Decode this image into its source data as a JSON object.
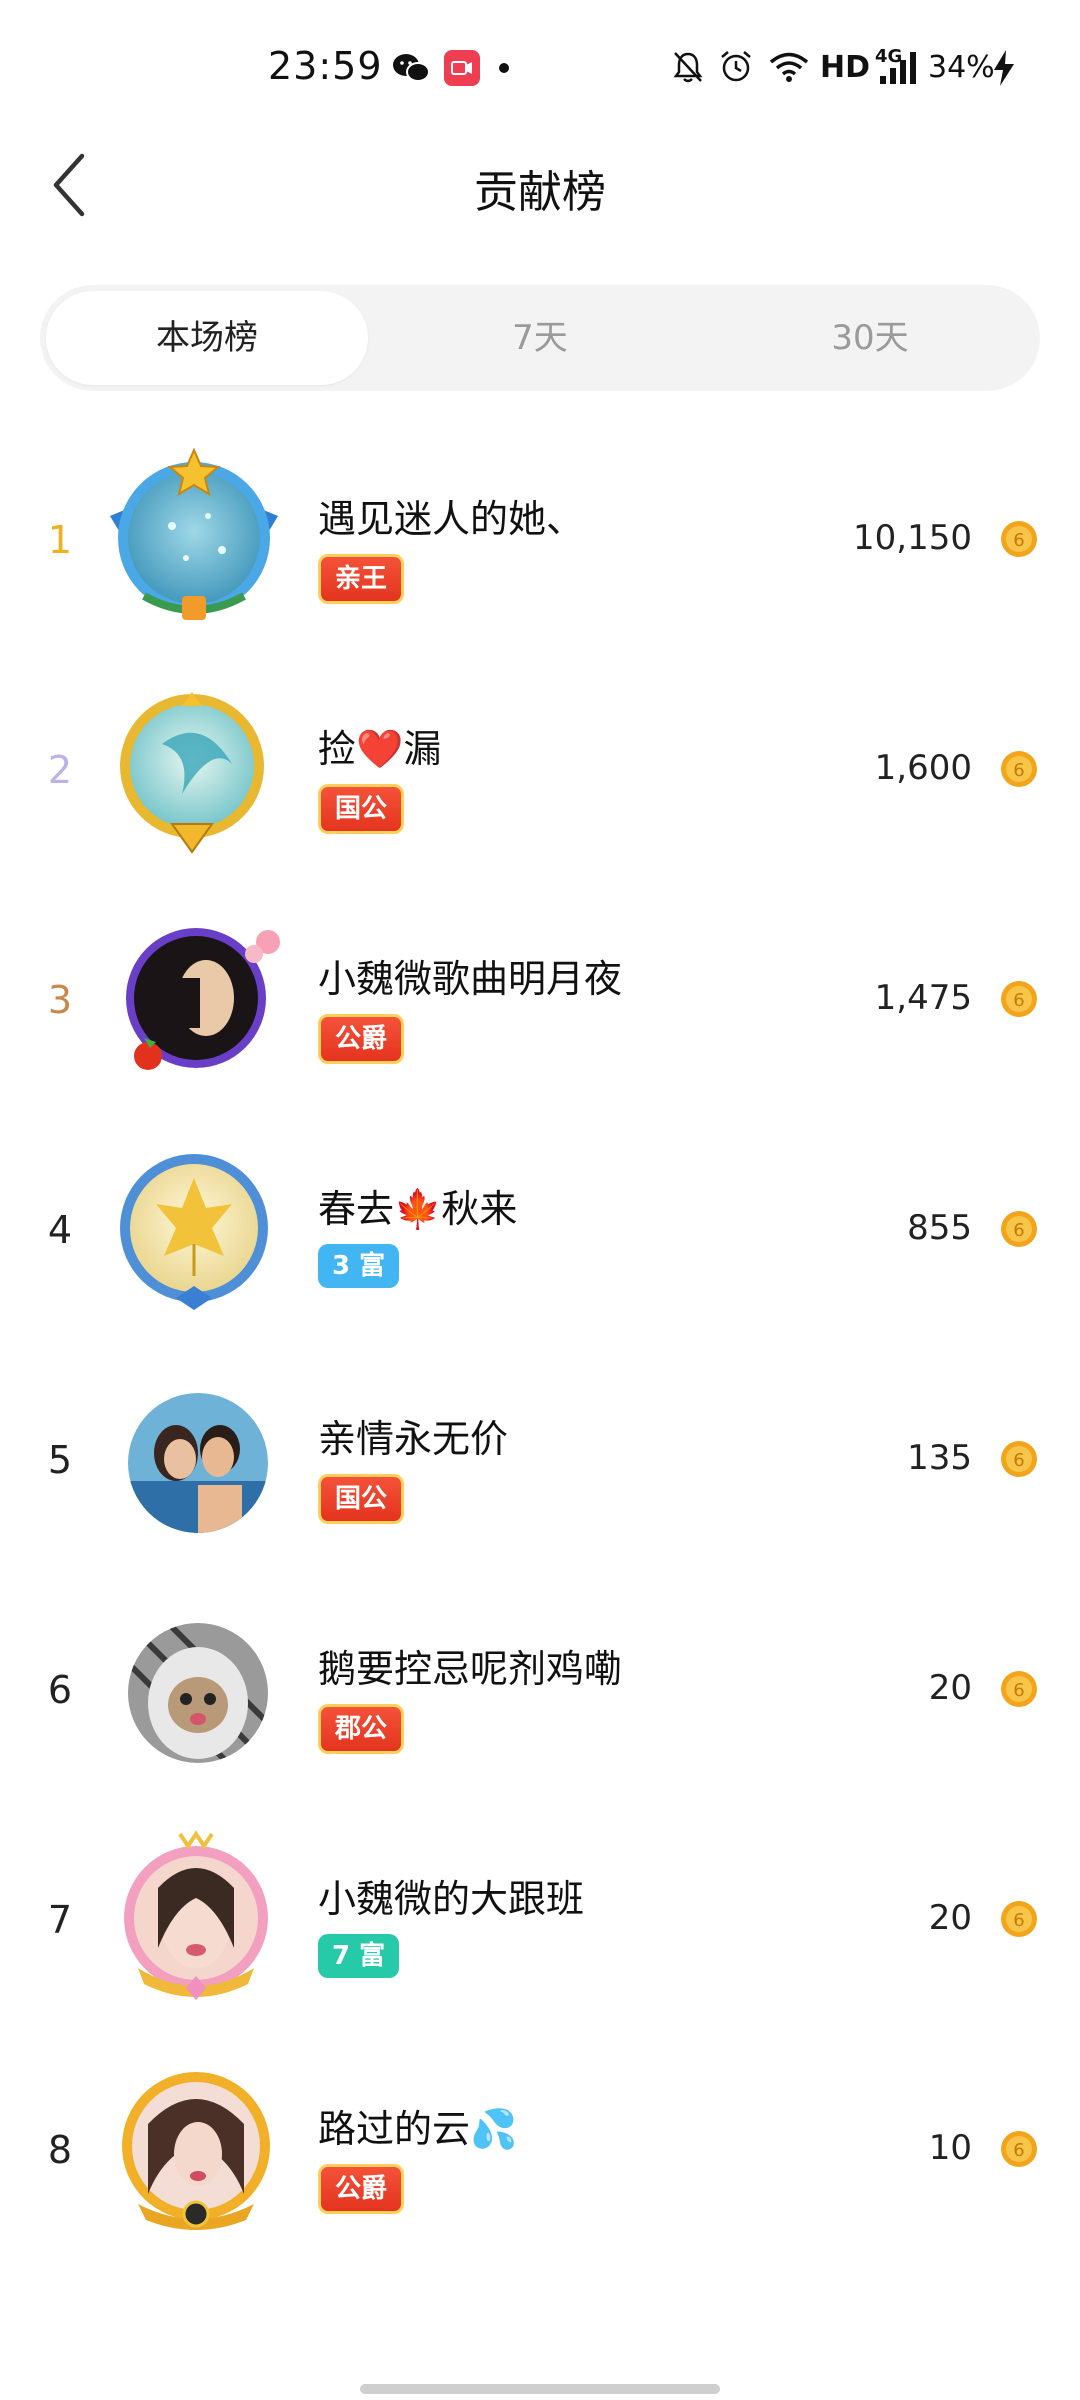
{
  "status_bar": {
    "time": "23:59",
    "hd": "HD",
    "network": "4G",
    "battery": "34%"
  },
  "header": {
    "title": "贡献榜"
  },
  "tabs": [
    {
      "label": "本场榜",
      "active": true
    },
    {
      "label": "7天",
      "active": false
    },
    {
      "label": "30天",
      "active": false
    }
  ],
  "ranking": [
    {
      "rank": "1",
      "name": "遇见迷人的她、",
      "badge": "亲王",
      "score": "10,150"
    },
    {
      "rank": "2",
      "name": "捡❤️漏",
      "badge": "国公",
      "score": "1,600"
    },
    {
      "rank": "3",
      "name": "小魏微歌曲明月夜",
      "badge": "公爵",
      "score": "1,475"
    },
    {
      "rank": "4",
      "name": "春去🍁秋来",
      "badge": "3 富",
      "score": "855"
    },
    {
      "rank": "5",
      "name": "亲情永无价",
      "badge": "国公",
      "score": "135"
    },
    {
      "rank": "6",
      "name": "鹅要控忌呢剂鸡嘞",
      "badge": "郡公",
      "score": "20"
    },
    {
      "rank": "7",
      "name": "小魏微的大跟班",
      "badge": "7 富",
      "score": "20"
    },
    {
      "rank": "8",
      "name": "路过的云💦",
      "badge": "公爵",
      "score": "10"
    }
  ],
  "colors": {
    "rank1": "#f2b01e",
    "rank2": "#b9b3e6",
    "rank3": "#c8894a",
    "rank_default": "#222222",
    "badge_red": "#e83a24",
    "badge_blue": "#41b6f2",
    "badge_teal": "#26c9a8",
    "coin": "#f2a51a"
  }
}
